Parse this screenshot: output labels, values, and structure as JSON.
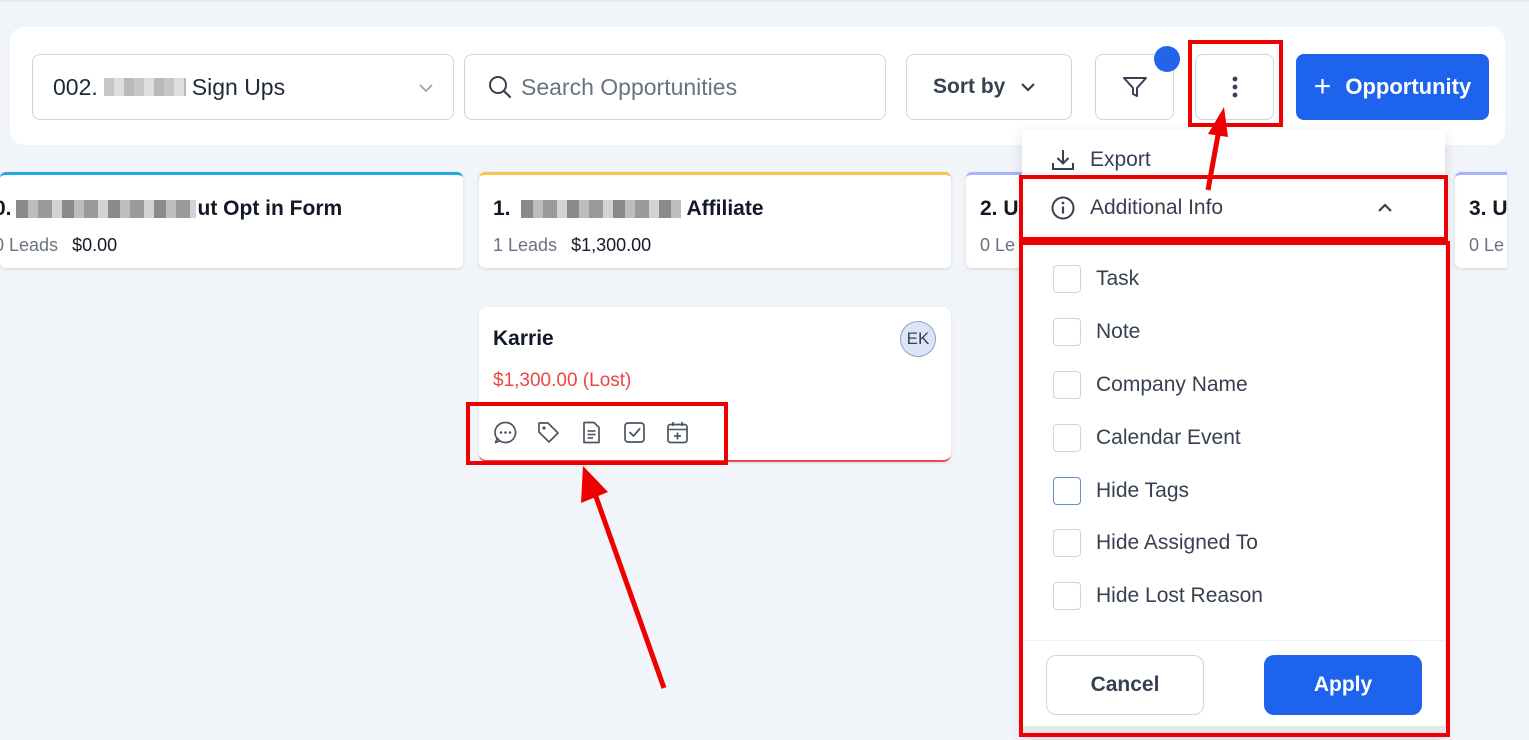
{
  "toolbar": {
    "pipeline_prefix": "002.",
    "pipeline_suffix": "Sign Ups",
    "search_placeholder": "Search Opportunities",
    "sort_label": "Sort by",
    "add_label": "Opportunity"
  },
  "stages": [
    {
      "title_prefix": "0.",
      "title_suffix": "ut Opt in Form",
      "leads": "0 Leads",
      "value": "$0.00"
    },
    {
      "title_prefix": "1.",
      "title_suffix": "Affiliate",
      "leads": "1 Leads",
      "value": "$1,300.00"
    },
    {
      "title_prefix": "2. U",
      "leads": "0 Le"
    },
    {
      "title_prefix": "3. U",
      "leads": "0 Le"
    }
  ],
  "opportunity": {
    "name": "Karrie",
    "value": "$1,300.00 (Lost)",
    "avatar": "EK",
    "icons": [
      "chat-icon",
      "tag-icon",
      "note-icon",
      "task-icon",
      "calendar-add-icon"
    ]
  },
  "menu": {
    "export_label": "Export",
    "additional_info_label": "Additional Info",
    "options": [
      "Task",
      "Note",
      "Company Name",
      "Calendar Event",
      "Hide Tags",
      "Hide Assigned To",
      "Hide Lost Reason"
    ],
    "cancel_label": "Cancel",
    "apply_label": "Apply"
  },
  "colors": {
    "primary": "#1d63ed",
    "lost": "#ef4444",
    "highlight": "#ee0000"
  }
}
